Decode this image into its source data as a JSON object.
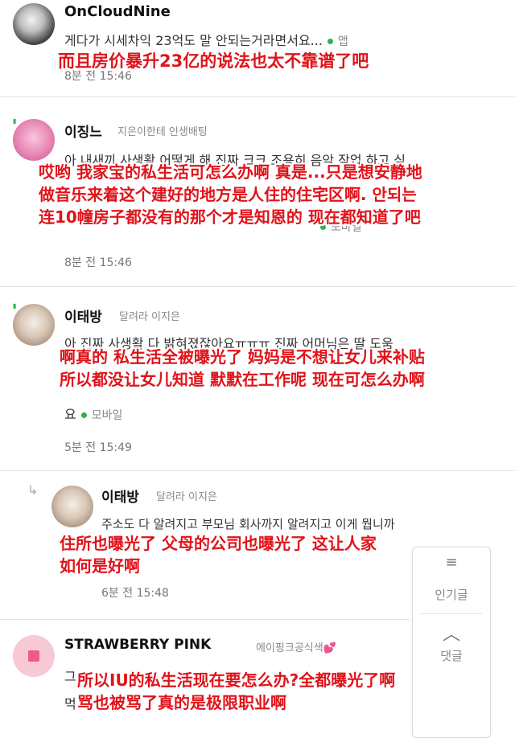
{
  "comments": [
    {
      "username": "OnCloudNine",
      "body_partial": "게다가 시세차익 23억도 말 안되는거라면서요...",
      "via": "앱",
      "time": "8분 전 15:46",
      "overlay": [
        "而且房价暴升23亿的说法也太不靠谱了吧"
      ]
    },
    {
      "username": "이징느",
      "subtitle": "지은이한테 인생배팅",
      "body_lines": [
        "아 내새끼 사생활 어떻게 해 진짜 크크 조용히 음악 작업 하고 싶"
      ],
      "body_suffix": "안되는",
      "via": "모바일",
      "time": "8분 전 15:46",
      "overlay": [
        "哎哟 我家宝的私生活可怎么办啊 真是...只是想安静地",
        "做音乐来着这个建好的地方是人住的住宅区啊. 안되는",
        "连10幢房子都没有的那个才是知恩的 现在都知道了吧"
      ]
    },
    {
      "username": "이태방",
      "subtitle": "달려라 이지은",
      "body_lines": [
        "아 진짜 사생활 다 밝혀졌잖아요ㅠㅠㅠ 진짜 어머님은 딸 도움"
      ],
      "body_end": "요",
      "via": "모바일",
      "time": "5분 전 15:49",
      "overlay": [
        "啊真的 私生活全被曝光了 妈妈是不想让女儿来补贴",
        "所以都没让女儿知道 默默在工作呢 现在可怎么办啊"
      ]
    },
    {
      "username": "이태방",
      "subtitle": "달려라 이지은",
      "body_lines": [
        "주소도 다 알려지고 부모님 회사까지 알려지고 이게 뭡니까"
      ],
      "time": "6분 전 15:48",
      "overlay": [
        "住所也曝光了 父母的公司也曝光了 这让人家",
        "如何是好啊"
      ]
    },
    {
      "username": "STRAWBERRY PINK",
      "subtitle": "에이핑크공식색💕",
      "body_lines": [
        "그",
        "먹"
      ],
      "overlay": [
        "所以IU的私生活现在要怎么办?全都曝光了啊",
        "骂也被骂了真的是极限职业啊"
      ]
    }
  ],
  "floating_panel": {
    "menu_icon": "≡",
    "popular_label": "인기글",
    "up_icon": "︿",
    "comments_label": "댓글"
  },
  "colors": {
    "overlay_red": "#e0131a",
    "online_dot": "#2bb24c"
  }
}
